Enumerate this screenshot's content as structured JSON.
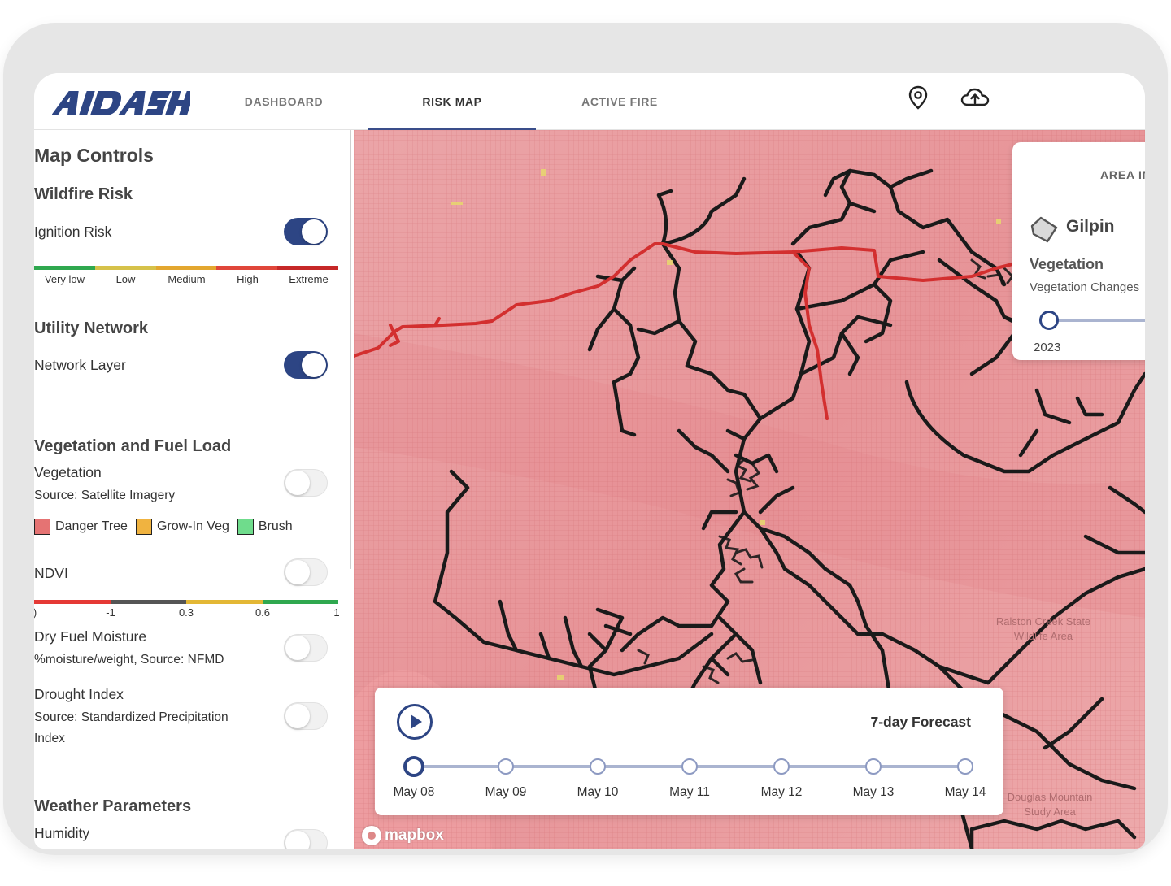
{
  "header": {
    "logo_text": "AIDASH",
    "tabs": [
      {
        "label": "DASHBOARD"
      },
      {
        "label": "RISK MAP"
      },
      {
        "label": "ACTIVE FIRE"
      }
    ],
    "active_tab": "RISK MAP",
    "icons": [
      "location-pin-icon",
      "cloud-upload-icon"
    ]
  },
  "sidebar": {
    "title": "Map Controls",
    "wildfire": {
      "heading": "Wildfire Risk",
      "ignition_label": "Ignition Risk",
      "ignition_on": true,
      "scale_labels": [
        "Very low",
        "Low",
        "Medium",
        "High",
        "Extreme"
      ],
      "scale_colors": [
        "#2fa84f",
        "#d6c24a",
        "#e3a72f",
        "#e0463a",
        "#c62828"
      ]
    },
    "utility": {
      "heading": "Utility Network",
      "network_label": "Network Layer",
      "network_on": true
    },
    "vegetation": {
      "heading": "Vegetation and Fuel Load",
      "veg_label": "Vegetation",
      "veg_source": "Source: Satellite Imagery",
      "legend": [
        {
          "label": "Danger Tree",
          "color": "#e57373"
        },
        {
          "label": "Grow-In Veg",
          "color": "#f0b340"
        },
        {
          "label": "Brush",
          "color": "#6fdc8c"
        }
      ],
      "ndvi_label": "NDVI",
      "ndvi_ticks": [
        "-1",
        "0.3",
        "0.6",
        "1"
      ],
      "ndvi_first_tick_partial": ")",
      "ndvi_colors": [
        "#e53935",
        "#555555",
        "#e3b735",
        "#2fa84f"
      ],
      "dry_fuel_label": "Dry Fuel Moisture",
      "dry_fuel_source": "%moisture/weight, Source: NFMD",
      "drought_label": "Drought Index",
      "drought_source": "Source: Standardized Precipitation Index"
    },
    "weather": {
      "heading": "Weather Parameters",
      "humidity_label": "Humidity"
    }
  },
  "map": {
    "attribution": "mapbox",
    "places": [
      {
        "name": "Ralston Creek State Wildlife Area"
      },
      {
        "name": "Douglas Mountain Study Area"
      }
    ],
    "area_card": {
      "title": "AREA IN",
      "name": "Gilpin",
      "section": "Vegetation",
      "subtitle": "Vegetation Changes",
      "year": "2023"
    },
    "forecast": {
      "title": "7-day Forecast",
      "dates": [
        "May 08",
        "May 09",
        "May 10",
        "May 11",
        "May 12",
        "May 13",
        "May 14"
      ],
      "selected_index": 0
    }
  },
  "colors": {
    "accent": "#2d4584",
    "map_risk": "#e8a0a3",
    "line_network": "#1a1a1a",
    "line_risk": "#d32f2f"
  }
}
